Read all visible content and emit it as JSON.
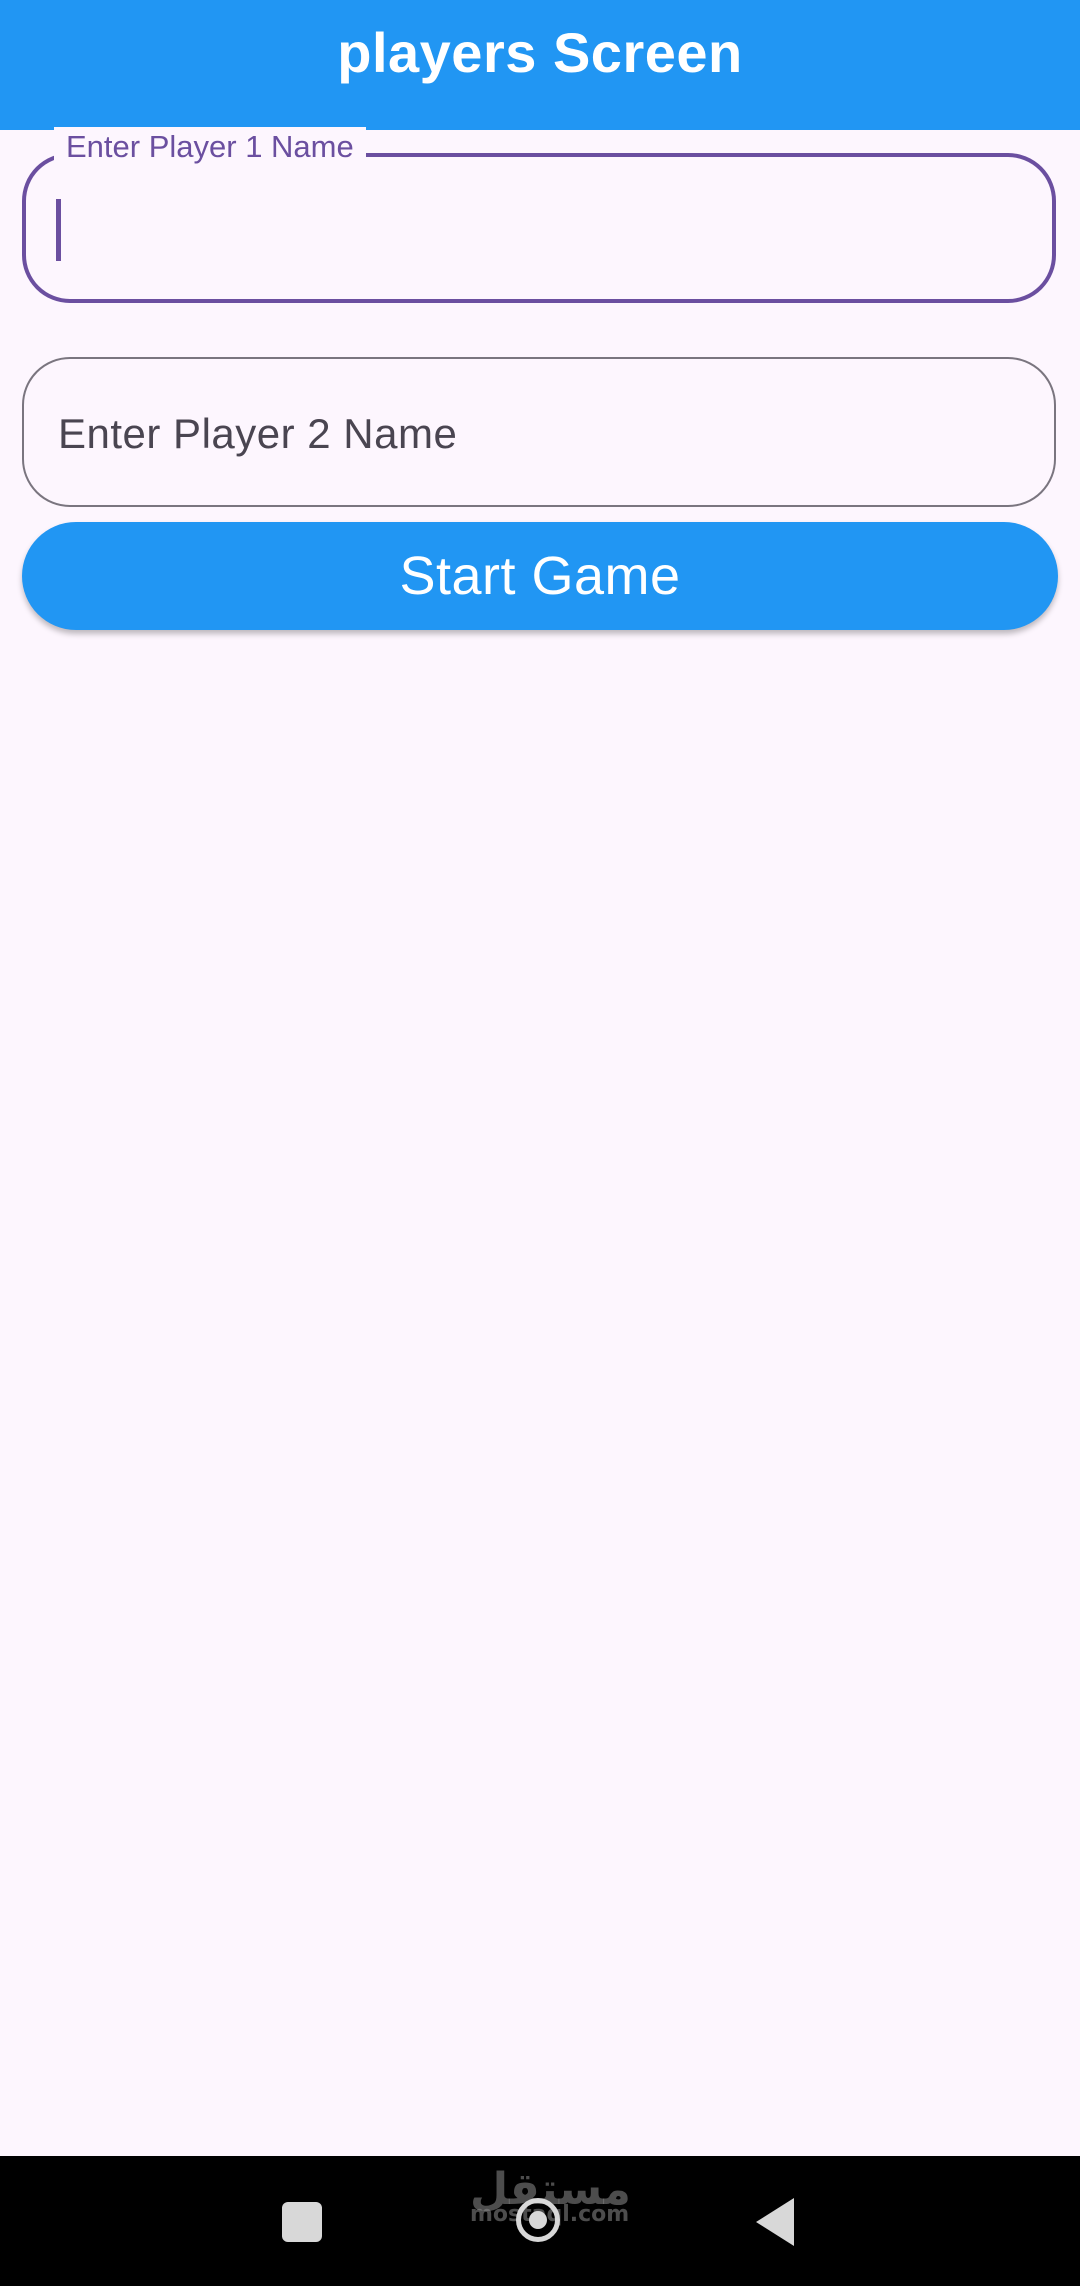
{
  "app_bar": {
    "title": "players Screen"
  },
  "player1_field": {
    "label": "Enter Player 1 Name",
    "value": "",
    "focused": true
  },
  "player2_field": {
    "placeholder": "Enter Player 2 Name",
    "value": ""
  },
  "start_button": {
    "label": "Start Game"
  },
  "nav_bar": {
    "recents_icon": "square-icon",
    "home_icon": "circle-icon",
    "back_icon": "triangle-back-icon",
    "watermark_arabic": "مستقل",
    "watermark_latin": "mostaql.com"
  },
  "colors": {
    "primary": "#2196f3",
    "focus": "#6b4fa0",
    "background": "#fdf6fe",
    "outline": "#7a757f"
  }
}
